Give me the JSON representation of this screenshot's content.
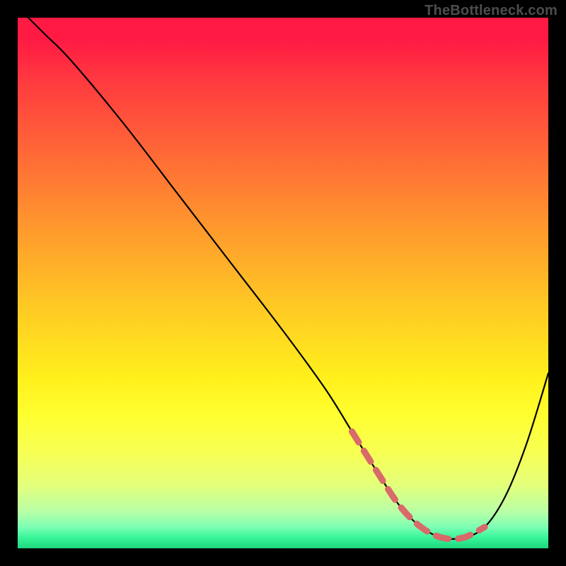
{
  "attribution": "TheBottleneck.com",
  "chart_data": {
    "type": "line",
    "title": "",
    "xlabel": "",
    "ylabel": "",
    "xlim": [
      0,
      100
    ],
    "ylim": [
      0,
      100
    ],
    "series": [
      {
        "name": "curve",
        "x": [
          2,
          5,
          10,
          20,
          30,
          40,
          50,
          58,
          63,
          68,
          72,
          76,
          80,
          84,
          88,
          92,
          96,
          100
        ],
        "y": [
          100,
          97,
          92,
          80,
          67,
          54,
          41,
          30,
          22,
          14,
          8,
          4,
          2,
          2,
          4,
          10,
          20,
          33
        ]
      }
    ],
    "marker_segment": {
      "color": "#d86a6a",
      "x_start": 63,
      "x_end": 88
    },
    "gradient_stops": [
      {
        "pos": 0,
        "color": "#ff1a44"
      },
      {
        "pos": 50,
        "color": "#ffd022"
      },
      {
        "pos": 85,
        "color": "#ffff40"
      },
      {
        "pos": 100,
        "color": "#1dd67e"
      }
    ]
  }
}
